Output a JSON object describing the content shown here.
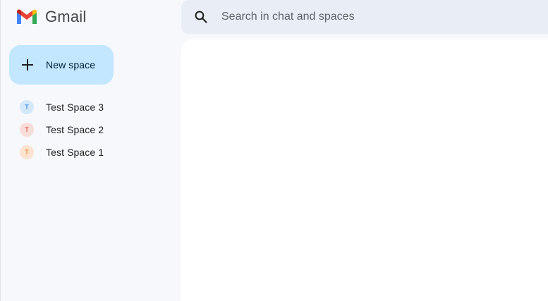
{
  "app": {
    "name": "Gmail",
    "logo_icon": "gmail-logo-icon"
  },
  "search": {
    "placeholder": "Search in chat and spaces",
    "value": "",
    "icon": "search-icon"
  },
  "new_space": {
    "label": "New space",
    "icon": "plus-icon",
    "color": "#c2e7ff"
  },
  "spaces": [
    {
      "initial": "T",
      "label": "Test Space 3",
      "avatar_bg": "#d3e8f8",
      "avatar_fg": "#1a73e8"
    },
    {
      "initial": "T",
      "label": "Test Space 2",
      "avatar_bg": "#f8ddd9",
      "avatar_fg": "#d93025"
    },
    {
      "initial": "T",
      "label": "Test Space 1",
      "avatar_bg": "#fbe3cf",
      "avatar_fg": "#e8710a"
    }
  ],
  "colors": {
    "background": "#f6f8fc",
    "search_bg": "#e9eef6",
    "panel_bg": "#ffffff"
  }
}
